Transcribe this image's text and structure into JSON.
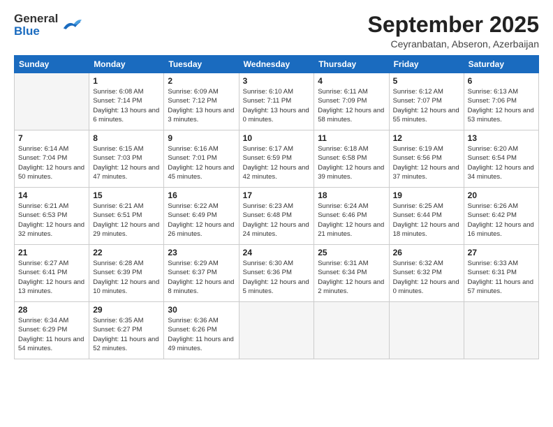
{
  "header": {
    "logo_general": "General",
    "logo_blue": "Blue",
    "month_title": "September 2025",
    "location": "Ceyranbatan, Abseron, Azerbaijan"
  },
  "days_of_week": [
    "Sunday",
    "Monday",
    "Tuesday",
    "Wednesday",
    "Thursday",
    "Friday",
    "Saturday"
  ],
  "weeks": [
    [
      {
        "day": "",
        "sunrise": "",
        "sunset": "",
        "daylight": ""
      },
      {
        "day": "1",
        "sunrise": "Sunrise: 6:08 AM",
        "sunset": "Sunset: 7:14 PM",
        "daylight": "Daylight: 13 hours and 6 minutes."
      },
      {
        "day": "2",
        "sunrise": "Sunrise: 6:09 AM",
        "sunset": "Sunset: 7:12 PM",
        "daylight": "Daylight: 13 hours and 3 minutes."
      },
      {
        "day": "3",
        "sunrise": "Sunrise: 6:10 AM",
        "sunset": "Sunset: 7:11 PM",
        "daylight": "Daylight: 13 hours and 0 minutes."
      },
      {
        "day": "4",
        "sunrise": "Sunrise: 6:11 AM",
        "sunset": "Sunset: 7:09 PM",
        "daylight": "Daylight: 12 hours and 58 minutes."
      },
      {
        "day": "5",
        "sunrise": "Sunrise: 6:12 AM",
        "sunset": "Sunset: 7:07 PM",
        "daylight": "Daylight: 12 hours and 55 minutes."
      },
      {
        "day": "6",
        "sunrise": "Sunrise: 6:13 AM",
        "sunset": "Sunset: 7:06 PM",
        "daylight": "Daylight: 12 hours and 53 minutes."
      }
    ],
    [
      {
        "day": "7",
        "sunrise": "Sunrise: 6:14 AM",
        "sunset": "Sunset: 7:04 PM",
        "daylight": "Daylight: 12 hours and 50 minutes."
      },
      {
        "day": "8",
        "sunrise": "Sunrise: 6:15 AM",
        "sunset": "Sunset: 7:03 PM",
        "daylight": "Daylight: 12 hours and 47 minutes."
      },
      {
        "day": "9",
        "sunrise": "Sunrise: 6:16 AM",
        "sunset": "Sunset: 7:01 PM",
        "daylight": "Daylight: 12 hours and 45 minutes."
      },
      {
        "day": "10",
        "sunrise": "Sunrise: 6:17 AM",
        "sunset": "Sunset: 6:59 PM",
        "daylight": "Daylight: 12 hours and 42 minutes."
      },
      {
        "day": "11",
        "sunrise": "Sunrise: 6:18 AM",
        "sunset": "Sunset: 6:58 PM",
        "daylight": "Daylight: 12 hours and 39 minutes."
      },
      {
        "day": "12",
        "sunrise": "Sunrise: 6:19 AM",
        "sunset": "Sunset: 6:56 PM",
        "daylight": "Daylight: 12 hours and 37 minutes."
      },
      {
        "day": "13",
        "sunrise": "Sunrise: 6:20 AM",
        "sunset": "Sunset: 6:54 PM",
        "daylight": "Daylight: 12 hours and 34 minutes."
      }
    ],
    [
      {
        "day": "14",
        "sunrise": "Sunrise: 6:21 AM",
        "sunset": "Sunset: 6:53 PM",
        "daylight": "Daylight: 12 hours and 32 minutes."
      },
      {
        "day": "15",
        "sunrise": "Sunrise: 6:21 AM",
        "sunset": "Sunset: 6:51 PM",
        "daylight": "Daylight: 12 hours and 29 minutes."
      },
      {
        "day": "16",
        "sunrise": "Sunrise: 6:22 AM",
        "sunset": "Sunset: 6:49 PM",
        "daylight": "Daylight: 12 hours and 26 minutes."
      },
      {
        "day": "17",
        "sunrise": "Sunrise: 6:23 AM",
        "sunset": "Sunset: 6:48 PM",
        "daylight": "Daylight: 12 hours and 24 minutes."
      },
      {
        "day": "18",
        "sunrise": "Sunrise: 6:24 AM",
        "sunset": "Sunset: 6:46 PM",
        "daylight": "Daylight: 12 hours and 21 minutes."
      },
      {
        "day": "19",
        "sunrise": "Sunrise: 6:25 AM",
        "sunset": "Sunset: 6:44 PM",
        "daylight": "Daylight: 12 hours and 18 minutes."
      },
      {
        "day": "20",
        "sunrise": "Sunrise: 6:26 AM",
        "sunset": "Sunset: 6:42 PM",
        "daylight": "Daylight: 12 hours and 16 minutes."
      }
    ],
    [
      {
        "day": "21",
        "sunrise": "Sunrise: 6:27 AM",
        "sunset": "Sunset: 6:41 PM",
        "daylight": "Daylight: 12 hours and 13 minutes."
      },
      {
        "day": "22",
        "sunrise": "Sunrise: 6:28 AM",
        "sunset": "Sunset: 6:39 PM",
        "daylight": "Daylight: 12 hours and 10 minutes."
      },
      {
        "day": "23",
        "sunrise": "Sunrise: 6:29 AM",
        "sunset": "Sunset: 6:37 PM",
        "daylight": "Daylight: 12 hours and 8 minutes."
      },
      {
        "day": "24",
        "sunrise": "Sunrise: 6:30 AM",
        "sunset": "Sunset: 6:36 PM",
        "daylight": "Daylight: 12 hours and 5 minutes."
      },
      {
        "day": "25",
        "sunrise": "Sunrise: 6:31 AM",
        "sunset": "Sunset: 6:34 PM",
        "daylight": "Daylight: 12 hours and 2 minutes."
      },
      {
        "day": "26",
        "sunrise": "Sunrise: 6:32 AM",
        "sunset": "Sunset: 6:32 PM",
        "daylight": "Daylight: 12 hours and 0 minutes."
      },
      {
        "day": "27",
        "sunrise": "Sunrise: 6:33 AM",
        "sunset": "Sunset: 6:31 PM",
        "daylight": "Daylight: 11 hours and 57 minutes."
      }
    ],
    [
      {
        "day": "28",
        "sunrise": "Sunrise: 6:34 AM",
        "sunset": "Sunset: 6:29 PM",
        "daylight": "Daylight: 11 hours and 54 minutes."
      },
      {
        "day": "29",
        "sunrise": "Sunrise: 6:35 AM",
        "sunset": "Sunset: 6:27 PM",
        "daylight": "Daylight: 11 hours and 52 minutes."
      },
      {
        "day": "30",
        "sunrise": "Sunrise: 6:36 AM",
        "sunset": "Sunset: 6:26 PM",
        "daylight": "Daylight: 11 hours and 49 minutes."
      },
      {
        "day": "",
        "sunrise": "",
        "sunset": "",
        "daylight": ""
      },
      {
        "day": "",
        "sunrise": "",
        "sunset": "",
        "daylight": ""
      },
      {
        "day": "",
        "sunrise": "",
        "sunset": "",
        "daylight": ""
      },
      {
        "day": "",
        "sunrise": "",
        "sunset": "",
        "daylight": ""
      }
    ]
  ]
}
